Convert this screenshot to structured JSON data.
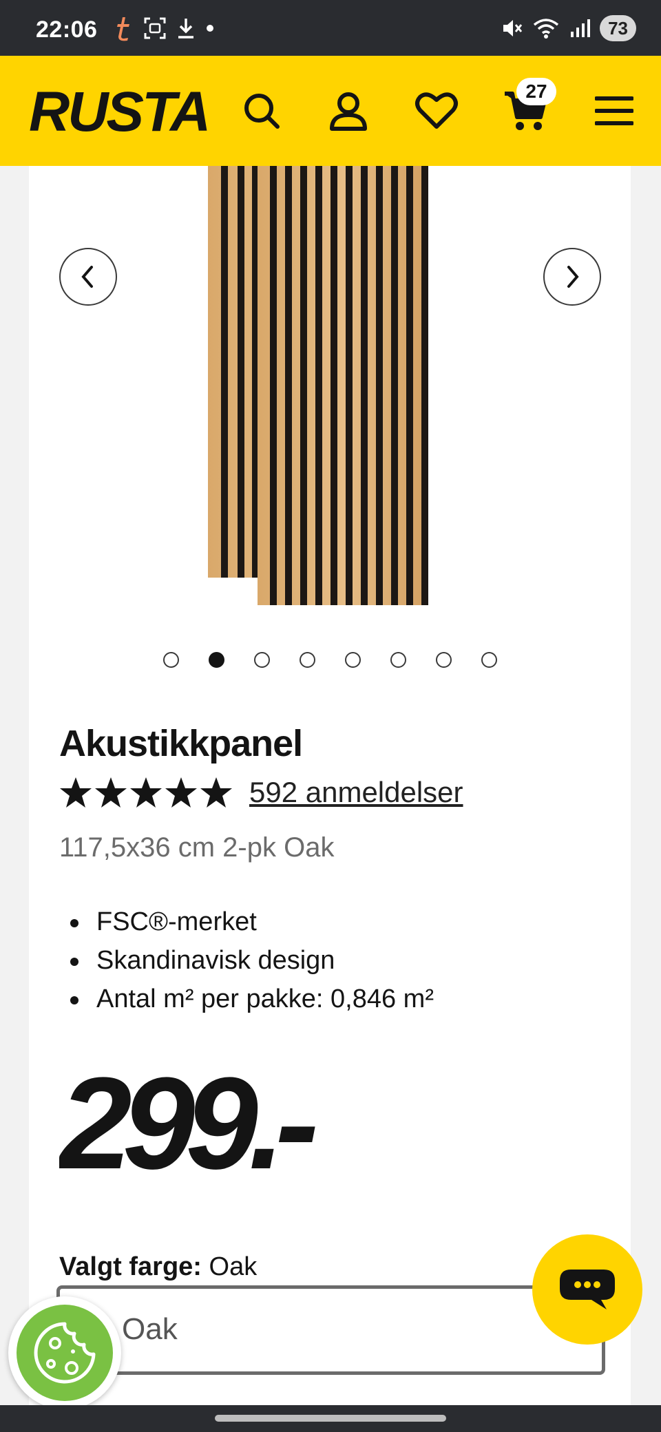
{
  "status_bar": {
    "time": "22:06",
    "battery": "73",
    "icons_left": [
      "t-app-icon",
      "screenshot-icon",
      "download-icon",
      "dot-icon"
    ],
    "icons_right": [
      "mute-icon",
      "wifi-icon",
      "signal-icon"
    ]
  },
  "header": {
    "logo_text": "RUSTA",
    "cart_count": "27",
    "icons": [
      "search-icon",
      "account-icon",
      "heart-icon",
      "cart-icon",
      "menu-icon"
    ],
    "background": "#ffd400"
  },
  "gallery": {
    "slide_count": 8,
    "active_index": 1
  },
  "product": {
    "title": "Akustikkpanel",
    "rating_stars": 5,
    "reviews": "592 anmeldelser",
    "variant": "117,5x36 cm 2-pk Oak",
    "features": [
      "FSC®-merket",
      "Skandinavisk design",
      "Antal m² per pakke: 0,846 m²"
    ],
    "price": "299.-",
    "color_label": "Valgt farge:",
    "color_value": "Oak",
    "select_value": "Oak"
  },
  "colors": {
    "accent": "#ffd400",
    "text": "#141414",
    "muted": "#6b6b6b",
    "cookie": "#7ac143"
  }
}
